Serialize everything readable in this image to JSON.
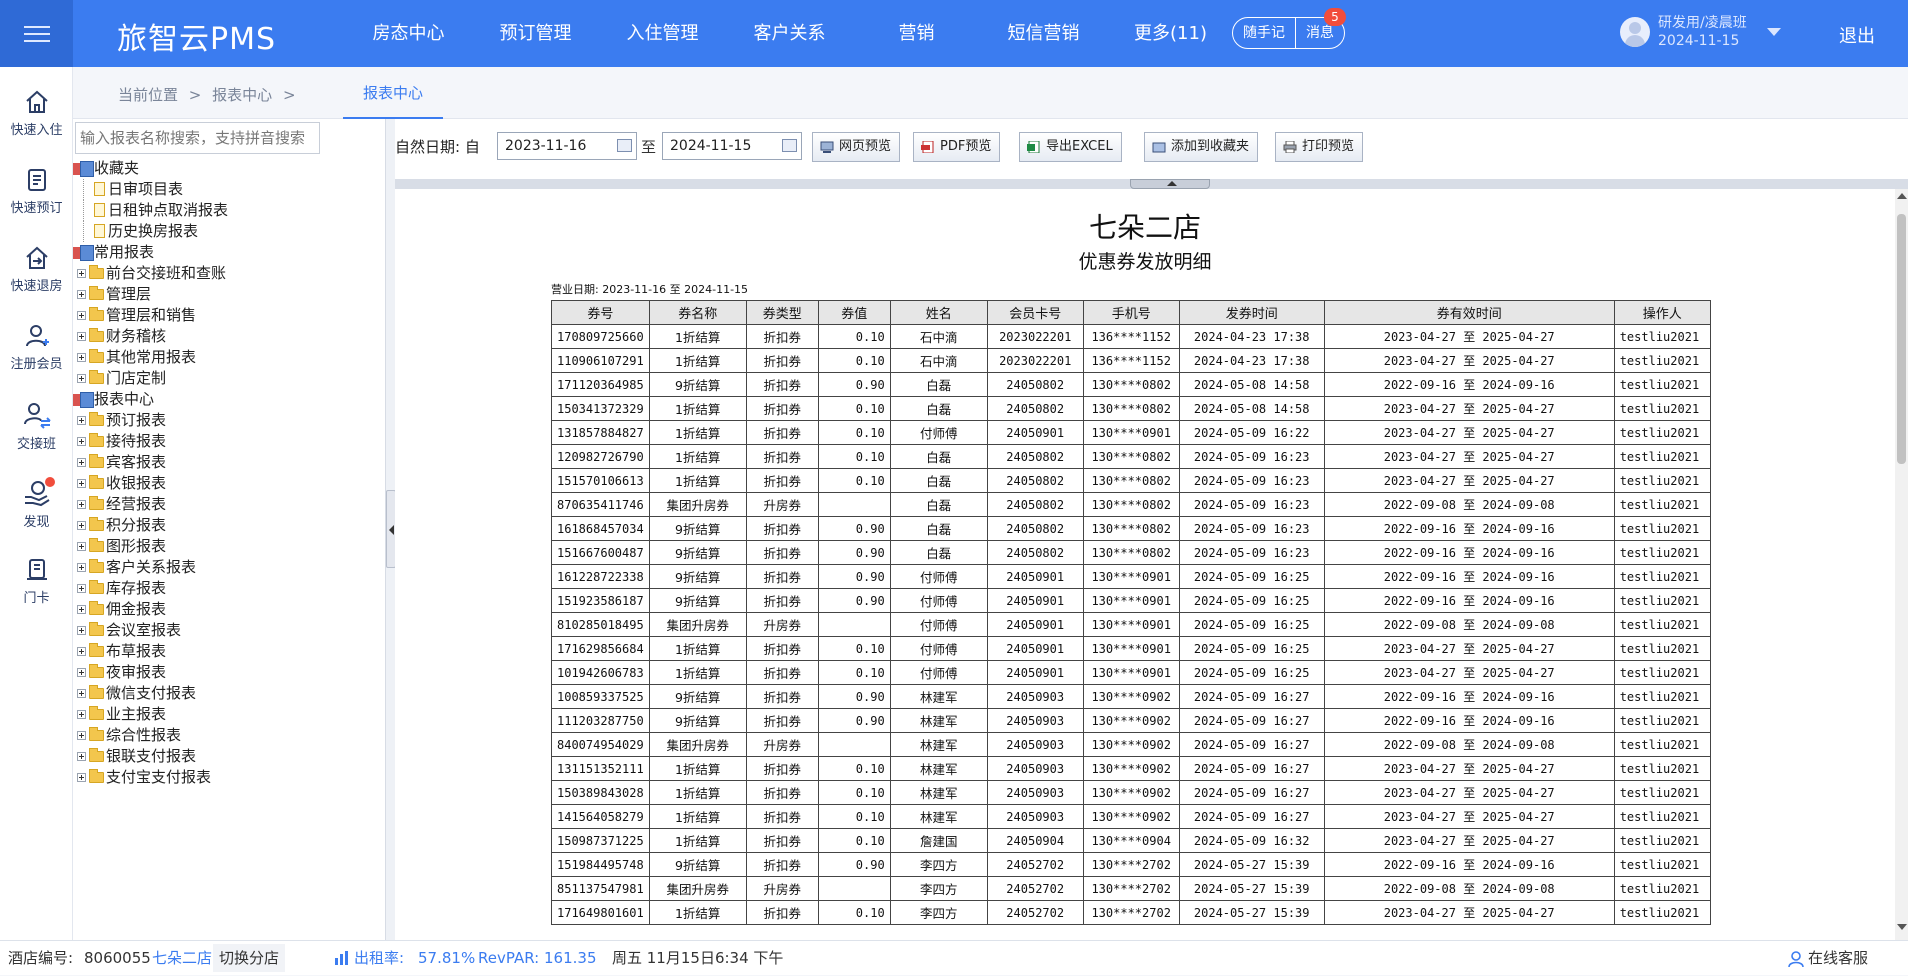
{
  "header": {
    "brand": "旅智云PMS",
    "nav": [
      "房态中心",
      "预订管理",
      "入住管理",
      "客户关系",
      "营销",
      "短信营销",
      "更多(11)"
    ],
    "notes_label": "随手记",
    "messages_label": "消息",
    "messages_count": "5",
    "user_name": "研发用/凌晨班",
    "user_date": "2024-11-15",
    "logout_label": "退出"
  },
  "quickbar": {
    "items": [
      "快速入住",
      "快速预订",
      "快速退房",
      "注册会员",
      "交接班",
      "发现",
      "门卡"
    ]
  },
  "breadcrumb": {
    "current_label": "当前位置",
    "sep": ">",
    "section": "报表中心",
    "active_tab": "报表中心"
  },
  "tree": {
    "search_placeholder": "输入报表名称搜索，支持拼音搜索",
    "favorites": "收藏夹",
    "favorite_items": [
      "日审项目表",
      "日租钟点取消报表",
      "历史换房报表"
    ],
    "common": "常用报表",
    "common_items": [
      "前台交接班和查账",
      "管理层",
      "管理层和销售",
      "财务稽核",
      "其他常用报表",
      "门店定制"
    ],
    "center": "报表中心",
    "center_items": [
      "预订报表",
      "接待报表",
      "宾客报表",
      "收银报表",
      "经营报表",
      "积分报表",
      "图形报表",
      "客户关系报表",
      "库存报表",
      "佣金报表",
      "会议室报表",
      "布草报表",
      "夜审报表",
      "微信支付报表",
      "业主报表",
      "综合性报表",
      "银联支付报表",
      "支付宝支付报表"
    ]
  },
  "filter": {
    "label": "自然日期:",
    "from_label": "自",
    "from_date": "2023-11-16",
    "to_label": "至",
    "to_date": "2024-11-15",
    "buttons": [
      "网页预览",
      "PDF预览",
      "导出EXCEL",
      "添加到收藏夹",
      "打印预览"
    ]
  },
  "report": {
    "hotel": "七朵二店",
    "title": "优惠券发放明细",
    "biz_date": "营业日期: 2023-11-16 至 2024-11-15",
    "columns": [
      "券号",
      "券名称",
      "券类型",
      "券值",
      "姓名",
      "会员卡号",
      "手机号",
      "发券时间",
      "券有效时间",
      "操作人"
    ],
    "rows": [
      [
        "170809725660",
        "1折结算",
        "折扣券",
        "0.10",
        "石中滴",
        "2023022201",
        "136****1152",
        "2024-04-23 17:38",
        "2023-04-27 至 2025-04-27",
        "testliu2021"
      ],
      [
        "110906107291",
        "1折结算",
        "折扣券",
        "0.10",
        "石中滴",
        "2023022201",
        "136****1152",
        "2024-04-23 17:38",
        "2023-04-27 至 2025-04-27",
        "testliu2021"
      ],
      [
        "171120364985",
        "9折结算",
        "折扣券",
        "0.90",
        "白磊",
        "24050802",
        "130****0802",
        "2024-05-08 14:58",
        "2022-09-16 至 2024-09-16",
        "testliu2021"
      ],
      [
        "150341372329",
        "1折结算",
        "折扣券",
        "0.10",
        "白磊",
        "24050802",
        "130****0802",
        "2024-05-08 14:58",
        "2023-04-27 至 2025-04-27",
        "testliu2021"
      ],
      [
        "131857884827",
        "1折结算",
        "折扣券",
        "0.10",
        "付师傅",
        "24050901",
        "130****0901",
        "2024-05-09 16:22",
        "2023-04-27 至 2025-04-27",
        "testliu2021"
      ],
      [
        "120982726790",
        "1折结算",
        "折扣券",
        "0.10",
        "白磊",
        "24050802",
        "130****0802",
        "2024-05-09 16:23",
        "2023-04-27 至 2025-04-27",
        "testliu2021"
      ],
      [
        "151570106613",
        "1折结算",
        "折扣券",
        "0.10",
        "白磊",
        "24050802",
        "130****0802",
        "2024-05-09 16:23",
        "2023-04-27 至 2025-04-27",
        "testliu2021"
      ],
      [
        "870635411746",
        "集团升房券",
        "升房券",
        "",
        "白磊",
        "24050802",
        "130****0802",
        "2024-05-09 16:23",
        "2022-09-08 至 2024-09-08",
        "testliu2021"
      ],
      [
        "161868457034",
        "9折结算",
        "折扣券",
        "0.90",
        "白磊",
        "24050802",
        "130****0802",
        "2024-05-09 16:23",
        "2022-09-16 至 2024-09-16",
        "testliu2021"
      ],
      [
        "151667600487",
        "9折结算",
        "折扣券",
        "0.90",
        "白磊",
        "24050802",
        "130****0802",
        "2024-05-09 16:23",
        "2022-09-16 至 2024-09-16",
        "testliu2021"
      ],
      [
        "161228722338",
        "9折结算",
        "折扣券",
        "0.90",
        "付师傅",
        "24050901",
        "130****0901",
        "2024-05-09 16:25",
        "2022-09-16 至 2024-09-16",
        "testliu2021"
      ],
      [
        "151923586187",
        "9折结算",
        "折扣券",
        "0.90",
        "付师傅",
        "24050901",
        "130****0901",
        "2024-05-09 16:25",
        "2022-09-16 至 2024-09-16",
        "testliu2021"
      ],
      [
        "810285018495",
        "集团升房券",
        "升房券",
        "",
        "付师傅",
        "24050901",
        "130****0901",
        "2024-05-09 16:25",
        "2022-09-08 至 2024-09-08",
        "testliu2021"
      ],
      [
        "171629856684",
        "1折结算",
        "折扣券",
        "0.10",
        "付师傅",
        "24050901",
        "130****0901",
        "2024-05-09 16:25",
        "2023-04-27 至 2025-04-27",
        "testliu2021"
      ],
      [
        "101942606783",
        "1折结算",
        "折扣券",
        "0.10",
        "付师傅",
        "24050901",
        "130****0901",
        "2024-05-09 16:25",
        "2023-04-27 至 2025-04-27",
        "testliu2021"
      ],
      [
        "100859337525",
        "9折结算",
        "折扣券",
        "0.90",
        "林建军",
        "24050903",
        "130****0902",
        "2024-05-09 16:27",
        "2022-09-16 至 2024-09-16",
        "testliu2021"
      ],
      [
        "111203287750",
        "9折结算",
        "折扣券",
        "0.90",
        "林建军",
        "24050903",
        "130****0902",
        "2024-05-09 16:27",
        "2022-09-16 至 2024-09-16",
        "testliu2021"
      ],
      [
        "840074954029",
        "集团升房券",
        "升房券",
        "",
        "林建军",
        "24050903",
        "130****0902",
        "2024-05-09 16:27",
        "2022-09-08 至 2024-09-08",
        "testliu2021"
      ],
      [
        "131151352111",
        "1折结算",
        "折扣券",
        "0.10",
        "林建军",
        "24050903",
        "130****0902",
        "2024-05-09 16:27",
        "2023-04-27 至 2025-04-27",
        "testliu2021"
      ],
      [
        "150389843028",
        "1折结算",
        "折扣券",
        "0.10",
        "林建军",
        "24050903",
        "130****0902",
        "2024-05-09 16:27",
        "2023-04-27 至 2025-04-27",
        "testliu2021"
      ],
      [
        "141564058279",
        "1折结算",
        "折扣券",
        "0.10",
        "林建军",
        "24050903",
        "130****0902",
        "2024-05-09 16:27",
        "2023-04-27 至 2025-04-27",
        "testliu2021"
      ],
      [
        "150987371225",
        "1折结算",
        "折扣券",
        "0.10",
        "詹建国",
        "24050904",
        "130****0904",
        "2024-05-09 16:32",
        "2023-04-27 至 2025-04-27",
        "testliu2021"
      ],
      [
        "151984495748",
        "9折结算",
        "折扣券",
        "0.90",
        "李四方",
        "24052702",
        "130****2702",
        "2024-05-27 15:39",
        "2022-09-16 至 2024-09-16",
        "testliu2021"
      ],
      [
        "851137547981",
        "集团升房券",
        "升房券",
        "",
        "李四方",
        "24052702",
        "130****2702",
        "2024-05-27 15:39",
        "2022-09-08 至 2024-09-08",
        "testliu2021"
      ],
      [
        "171649801601",
        "1折结算",
        "折扣券",
        "0.10",
        "李四方",
        "24052702",
        "130****2702",
        "2024-05-27 15:39",
        "2023-04-27 至 2025-04-27",
        "testliu2021"
      ]
    ]
  },
  "status": {
    "hotel_no_label": "酒店编号:",
    "hotel_no": "8060055",
    "hotel_name": "七朵二店",
    "switch_label": "切换分店",
    "occupancy_label": "出租率:",
    "occupancy": "57.81%",
    "revpar_label": "RevPAR:",
    "revpar": "161.35",
    "datetime": "周五 11月15日6:34 下午",
    "support_label": "在线客服"
  },
  "colors": {
    "primary": "#3b7cf0",
    "badge": "#f14d3c"
  }
}
